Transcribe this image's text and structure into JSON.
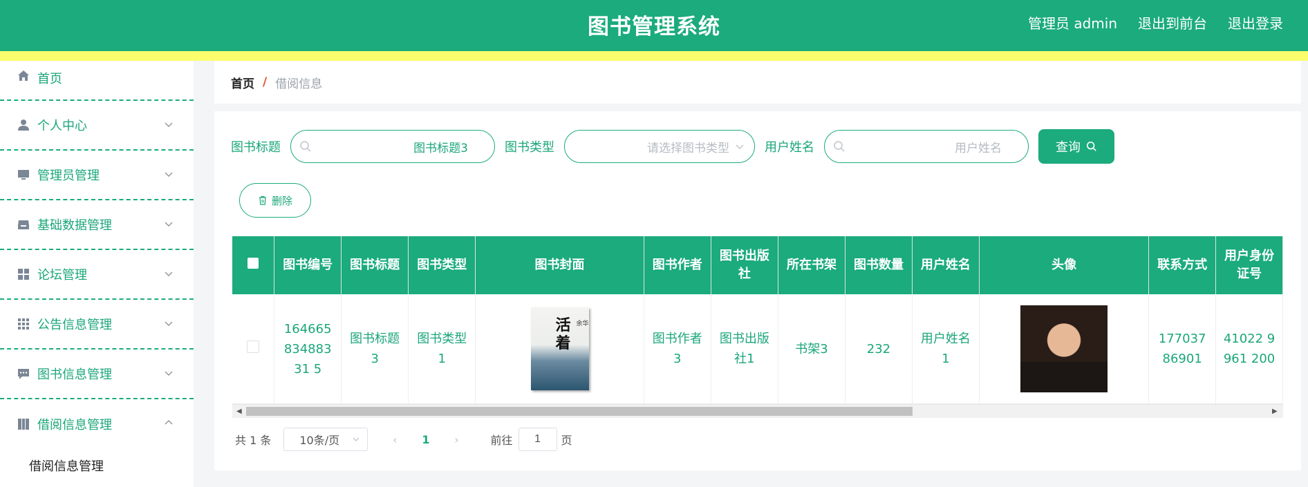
{
  "header": {
    "title": "图书管理系统",
    "admin_label": "管理员 admin",
    "to_front": "退出到前台",
    "logout": "退出登录"
  },
  "sidebar": {
    "items": [
      {
        "label": "首页",
        "icon": "home-icon"
      },
      {
        "label": "个人中心",
        "icon": "user-icon"
      },
      {
        "label": "管理员管理",
        "icon": "monitor-icon"
      },
      {
        "label": "基础数据管理",
        "icon": "inbox-icon"
      },
      {
        "label": "论坛管理",
        "icon": "grid-icon"
      },
      {
        "label": "公告信息管理",
        "icon": "apps-icon"
      },
      {
        "label": "图书信息管理",
        "icon": "chat-icon"
      },
      {
        "label": "借阅信息管理",
        "icon": "book-icon"
      }
    ],
    "sub_item": "借阅信息管理"
  },
  "breadcrumb": {
    "home": "首页",
    "separator": "/",
    "current": "借阅信息"
  },
  "search": {
    "title_label": "图书标题",
    "title_value": "图书标题3",
    "type_label": "图书类型",
    "type_placeholder": "请选择图书类型",
    "username_label": "用户姓名",
    "username_placeholder": "用户姓名",
    "query_button": "查询"
  },
  "toolbar": {
    "delete_button": "删除"
  },
  "table": {
    "headers": [
      "图书编号",
      "图书标题",
      "图书类型",
      "图书封面",
      "图书作者",
      "图书出版社",
      "所在书架",
      "图书数量",
      "用户姓名",
      "头像",
      "联系方式",
      "用户身份证号"
    ],
    "row": {
      "book_no": "16466583488331 5",
      "book_title": "图书标题3",
      "book_type": "图书类型1",
      "cover_title": "活着",
      "cover_author": "余华",
      "author": "图书作者3",
      "publisher": "图书出版社1",
      "shelf": "书架3",
      "quantity": "232",
      "username": "用户姓名1",
      "phone": "17703786901",
      "id_card": "41022 9961 200"
    }
  },
  "pagination": {
    "total": "共 1 条",
    "page_size": "10条/页",
    "prev": "‹",
    "current_page": "1",
    "next": "›",
    "goto_label": "前往",
    "goto_value": "1",
    "page_suffix": "页"
  },
  "colors": {
    "primary": "#1bab7c",
    "yellow_strip": "#fbfd6d",
    "text_green": "#1ba67a"
  }
}
